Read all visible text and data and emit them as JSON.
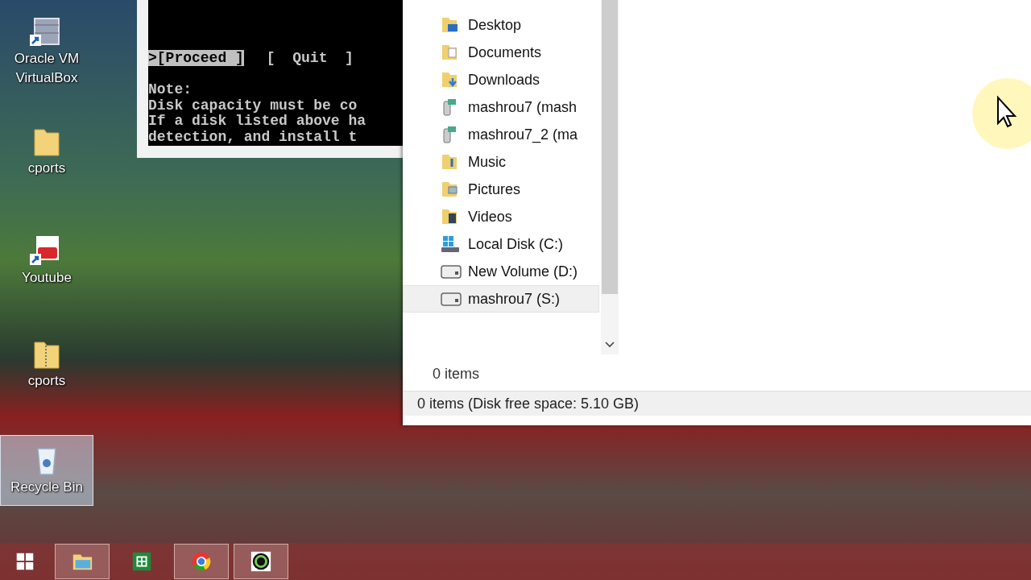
{
  "desktop_icons": [
    {
      "label": "Oracle VM VirtualBox",
      "kind": "virtualbox",
      "selected": false
    },
    {
      "label": "cports",
      "kind": "folder",
      "selected": false
    },
    {
      "label": "Youtube",
      "kind": "youtube",
      "selected": false
    },
    {
      "label": "cports",
      "kind": "zipfolder",
      "selected": false
    },
    {
      "label": "Recycle Bin",
      "kind": "recyclebin",
      "selected": true
    }
  ],
  "console": {
    "buttons": [
      {
        "label": ">[Proceed ]",
        "selected": true
      },
      {
        "label": "[  Quit  ]",
        "selected": false
      }
    ],
    "lines": [
      "Note:",
      "Disk capacity must be co",
      "If a disk listed above ha",
      "detection, and install t"
    ]
  },
  "explorer": {
    "nav_items": [
      {
        "label": "Desktop",
        "kind": "desktop",
        "selected": false
      },
      {
        "label": "Documents",
        "kind": "documents",
        "selected": false
      },
      {
        "label": "Downloads",
        "kind": "downloads",
        "selected": false
      },
      {
        "label": "mashrou7 (mash",
        "kind": "network-drive",
        "selected": false
      },
      {
        "label": "mashrou7_2 (ma",
        "kind": "network-drive",
        "selected": false
      },
      {
        "label": "Music",
        "kind": "music",
        "selected": false
      },
      {
        "label": "Pictures",
        "kind": "pictures",
        "selected": false
      },
      {
        "label": "Videos",
        "kind": "videos",
        "selected": false
      },
      {
        "label": "Local Disk (C:)",
        "kind": "system-drive",
        "selected": false
      },
      {
        "label": "New Volume (D:)",
        "kind": "drive",
        "selected": false
      },
      {
        "label": "mashrou7 (S:)",
        "kind": "drive",
        "selected": true
      }
    ],
    "item_count": "0 items",
    "status_bar": "0 items (Disk free space: 5.10 GB)"
  },
  "taskbar": {
    "buttons": [
      {
        "kind": "start",
        "active": false
      },
      {
        "kind": "file-explorer",
        "active": true
      },
      {
        "kind": "spreadsheet",
        "active": false
      },
      {
        "kind": "browser",
        "active": true
      },
      {
        "kind": "camera",
        "active": true
      }
    ]
  }
}
